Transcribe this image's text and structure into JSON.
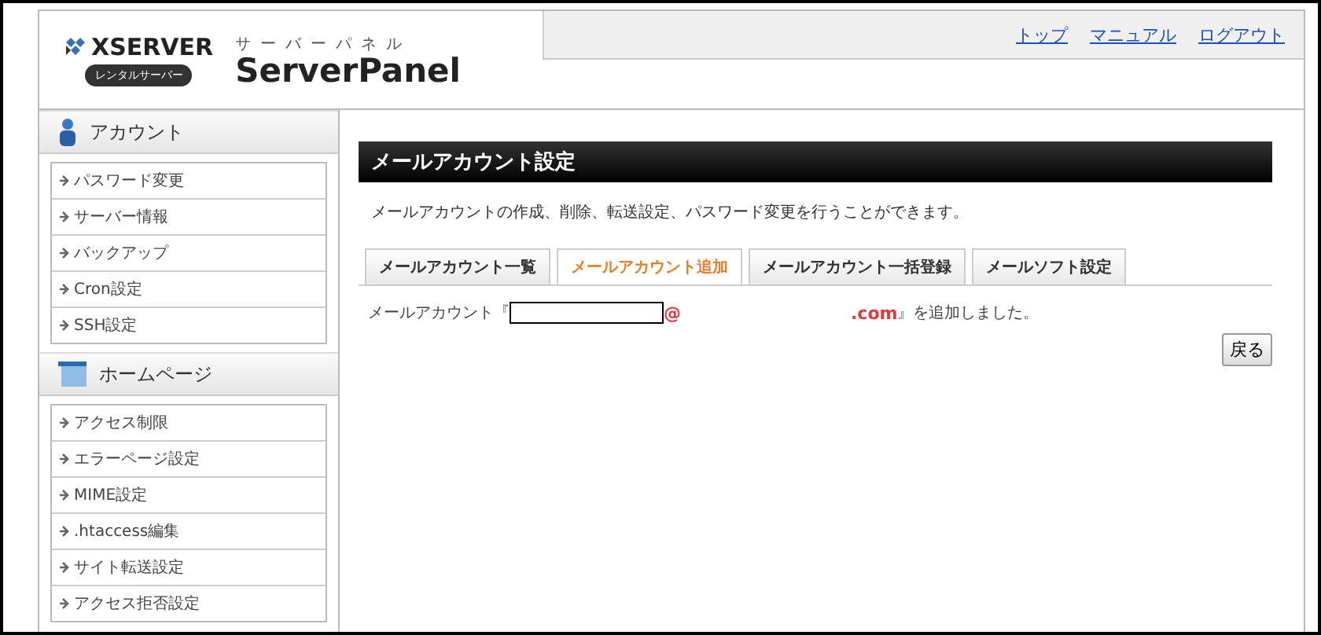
{
  "header": {
    "logo": {
      "brand": "XSERVER",
      "badge": "レンタルサーバー"
    },
    "product": {
      "kana": "サーバーパネル",
      "name": "ServerPanel"
    },
    "links": [
      "トップ",
      "マニュアル",
      "ログアウト"
    ]
  },
  "sidebar": [
    {
      "title": "アカウント",
      "kind": "person",
      "items": [
        "パスワード変更",
        "サーバー情報",
        "バックアップ",
        "Cron設定",
        "SSH設定"
      ]
    },
    {
      "title": "ホームページ",
      "kind": "page",
      "items": [
        "アクセス制限",
        "エラーページ設定",
        "MIME設定",
        ".htaccess編集",
        "サイト転送設定",
        "アクセス拒否設定"
      ]
    }
  ],
  "main": {
    "title": "メールアカウント設定",
    "description": "メールアカウントの作成、削除、転送設定、パスワード変更を行うことができます。",
    "tabs": [
      {
        "label": "メールアカウント一覧",
        "selected": false
      },
      {
        "label": "メールアカウント追加",
        "selected": true
      },
      {
        "label": "メールアカウント一括登録",
        "selected": false
      },
      {
        "label": "メールソフト設定",
        "selected": false
      }
    ],
    "result": {
      "prefix": "メールアカウント『",
      "at": "@",
      "domain": ".com",
      "suffix": "』を追加しました。"
    },
    "back_button": "戻る"
  }
}
